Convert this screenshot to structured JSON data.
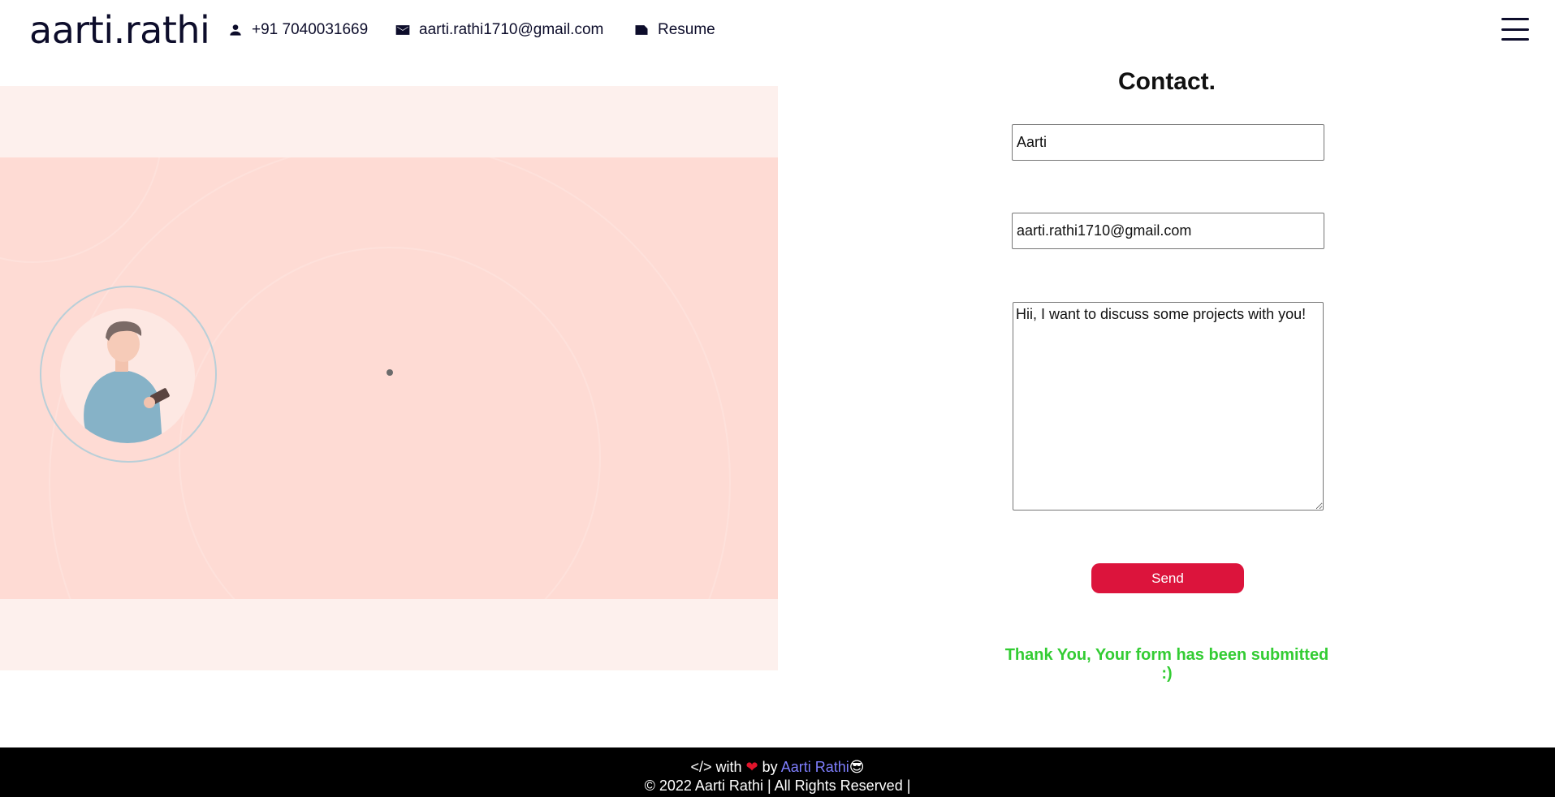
{
  "header": {
    "brand": "aarti.rathi",
    "phone": "+91 7040031669",
    "email": "aarti.rathi1710@gmail.com",
    "resume": "Resume",
    "icons": {
      "phone": "person-icon",
      "email": "mail-icon",
      "resume": "label-icon",
      "menu": "hamburger-menu-icon"
    }
  },
  "form": {
    "title": "Contact.",
    "name_value": "Aarti",
    "email_value": "aarti.rathi1710@gmail.com",
    "message_value": "Hii, I want to discuss some projects with you!",
    "send_label": "Send",
    "success_message": "Thank You, Your form has been submitted :)"
  },
  "footer": {
    "code_symbol": "</> with",
    "heart": "❤",
    "by": "by",
    "author": "Aarti Rathi",
    "emoji": "😎",
    "copyright": "© 2022 Aarti Rathi | All Rights Reserved |"
  },
  "colors": {
    "brand": "#0d0d2b",
    "send_button": "#dc143c",
    "success": "#33cc33",
    "illustration_bg": "#fedbd4",
    "footer_bg": "#000000",
    "footer_link": "#7f7fff"
  }
}
